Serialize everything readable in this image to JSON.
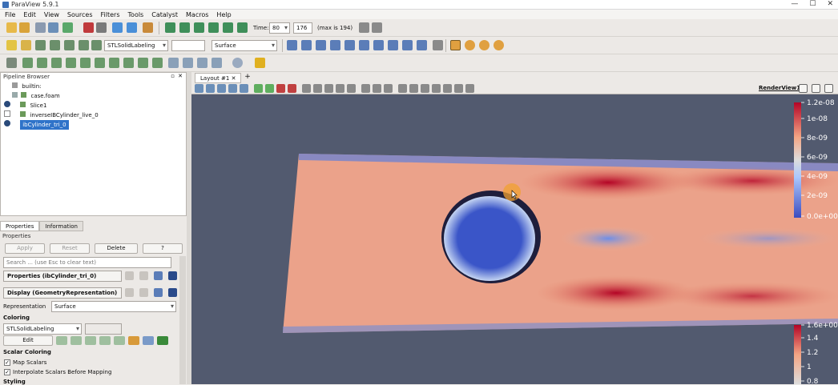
{
  "window": {
    "title": "ParaView 5.9.1",
    "controls": [
      "—",
      "☐",
      "✕"
    ]
  },
  "menu": [
    "File",
    "Edit",
    "View",
    "Sources",
    "Filters",
    "Tools",
    "Catalyst",
    "Macros",
    "Help"
  ],
  "toolbar": {
    "time_label": "Time:",
    "time_value": "80",
    "time_index": "176",
    "time_max": "(max is 194)",
    "coloring_array": "STLSolidLabeling",
    "representation": "Surface"
  },
  "pipeline_browser": {
    "title": "Pipeline Browser",
    "items": [
      {
        "label": "builtin:"
      },
      {
        "label": "case.foam"
      },
      {
        "label": "Slice1"
      },
      {
        "label": "inverseIBCylinder_live_0"
      },
      {
        "label": "ibCylinder_tri_0"
      }
    ]
  },
  "properties_panel": {
    "tabs": [
      "Properties",
      "Information"
    ],
    "title": "Properties",
    "apply_label": "Apply",
    "reset_label": "Reset",
    "delete_label": "Delete",
    "help_label": "?",
    "search_placeholder": "Search ... (use Esc to clear text)",
    "section_properties": "Properties (ibCylinder_tri_0)",
    "section_display": "Display (GeometryRepresentation)",
    "representation_label": "Representation",
    "representation_value": "Surface",
    "coloring_heading": "Coloring",
    "coloring_value": "STLSolidLabeling",
    "edit_label": "Edit",
    "scalar_coloring_heading": "Scalar Coloring",
    "map_scalars": "Map Scalars",
    "interpolate_scalars": "Interpolate Scalars Before Mapping",
    "styling_heading": "Styling"
  },
  "view": {
    "tab_label": "Layout #1",
    "render_view_label": "RenderView1"
  },
  "colorbar_top": {
    "ticks": [
      "1.2e-08",
      "1e-08",
      "8e-09",
      "6e-09",
      "4e-09",
      "2e-09",
      "0.0e+00"
    ]
  },
  "colorbar_bottom": {
    "ticks": [
      "1.6e+00",
      "1.4",
      "1.2",
      "1",
      "0.8"
    ]
  },
  "colors": {
    "background": "#525a6f",
    "accent_blue": "#3d5bd0",
    "accent_red": "#b4102a",
    "selection": "#2f73c9"
  }
}
